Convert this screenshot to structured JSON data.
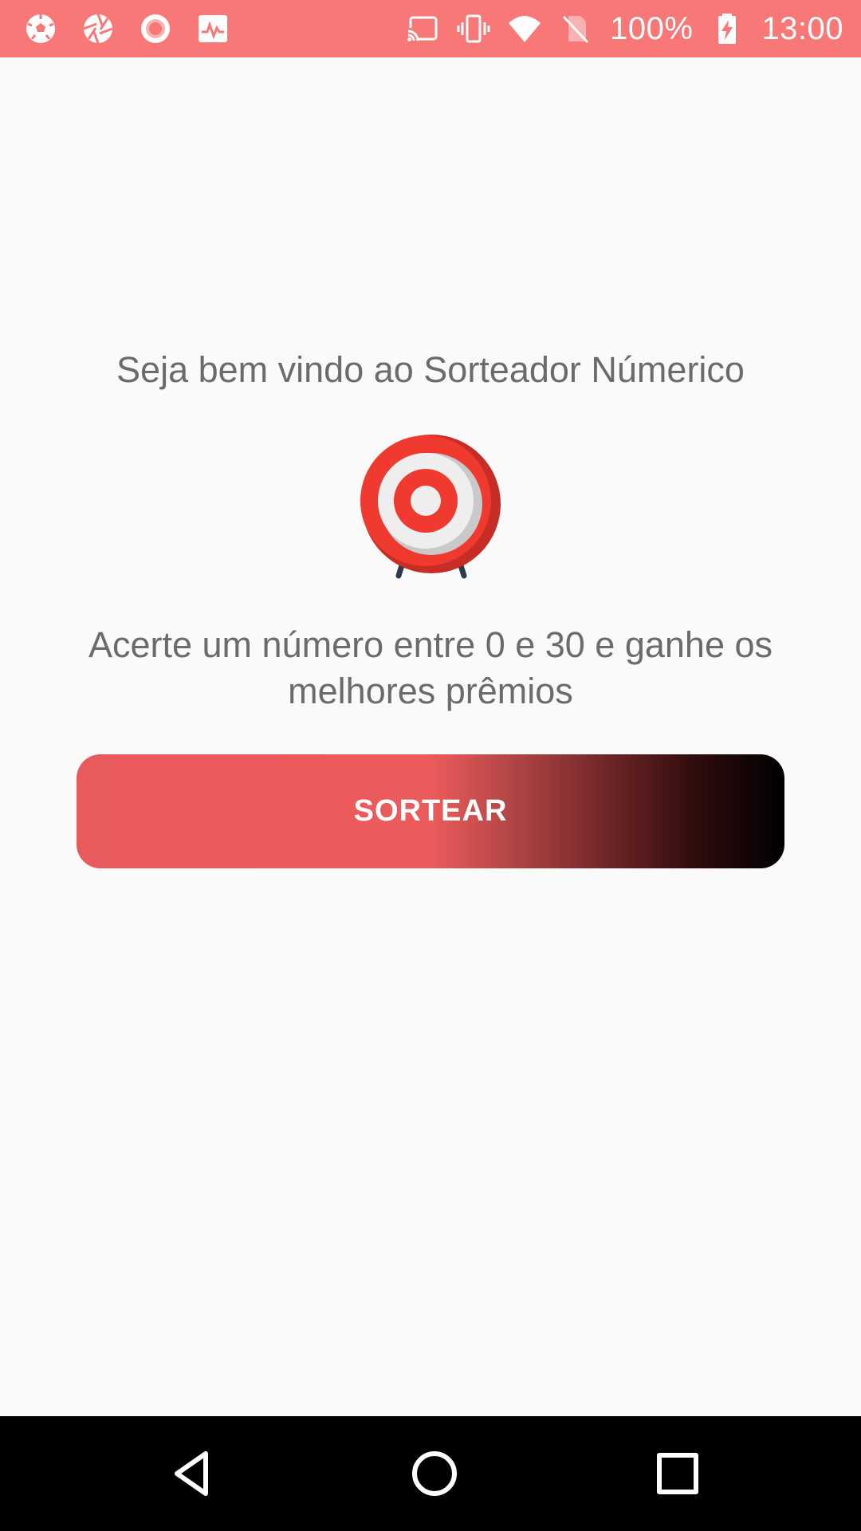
{
  "status_bar": {
    "battery": "100%",
    "time": "13:00",
    "left_icons": [
      "soccer-ball-icon",
      "camera-aperture-icon",
      "record-icon",
      "activity-monitor-icon"
    ],
    "right_icons": [
      "cast-icon",
      "vibrate-icon",
      "wifi-icon",
      "no-sim-icon",
      "battery-charging-icon"
    ],
    "background_color": "#f87777"
  },
  "main": {
    "welcome_text": "Seja bem vindo ao Sorteador Númerico",
    "logo_icon": "target-icon",
    "info_text": "Acerte um número entre 0 e 30 e ganhe os melhores prêmios",
    "button_label": "SORTEAR",
    "text_color": "#6b6b6b",
    "button_gradient": [
      "#ec5b5b",
      "#000000"
    ]
  },
  "nav_bar": {
    "buttons": [
      "back-icon",
      "home-icon",
      "recents-icon"
    ]
  }
}
